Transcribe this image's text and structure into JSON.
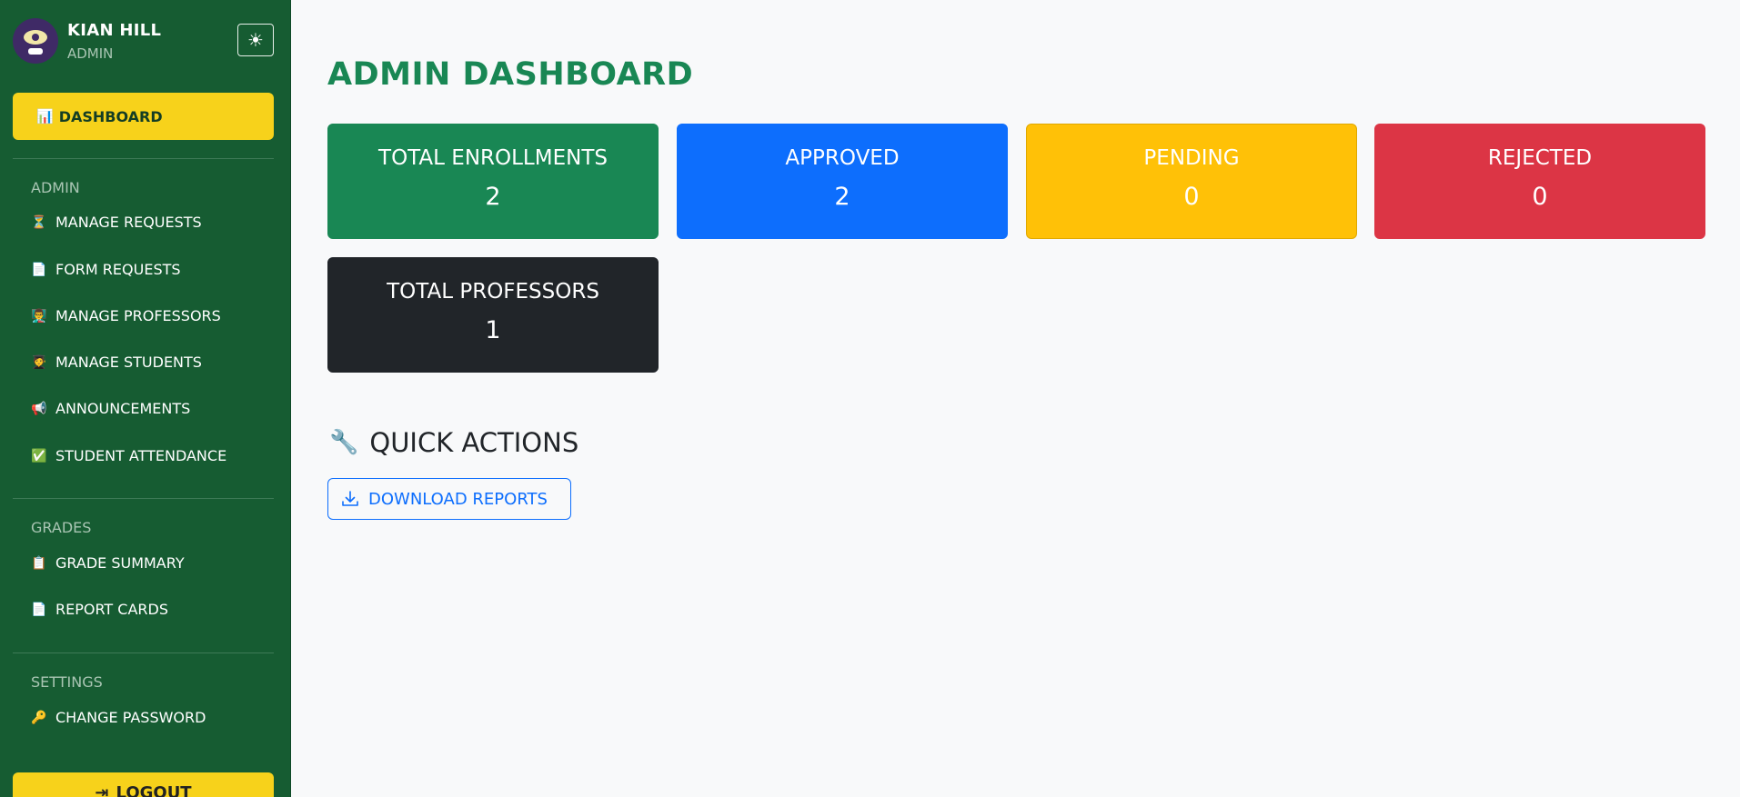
{
  "user": {
    "name": "KIAN HILL",
    "role": "ADMIN"
  },
  "theme_toggle_glyph": "☀",
  "sidebar": {
    "active": {
      "icon": "📊",
      "label": "DASHBOARD"
    },
    "sections": [
      {
        "label": "ADMIN",
        "items": [
          {
            "icon": "⏳",
            "label": "MANAGE REQUESTS"
          },
          {
            "icon": "📄",
            "label": "FORM REQUESTS"
          },
          {
            "icon": "👨‍🏫",
            "label": "MANAGE PROFESSORS"
          },
          {
            "icon": "🧑‍🎓",
            "label": "MANAGE STUDENTS"
          },
          {
            "icon": "📢",
            "label": "ANNOUNCEMENTS"
          },
          {
            "icon": "✅",
            "label": "STUDENT ATTENDANCE"
          }
        ]
      },
      {
        "label": "GRADES",
        "items": [
          {
            "icon": "📋",
            "label": "GRADE SUMMARY"
          },
          {
            "icon": "📄",
            "label": "REPORT CARDS"
          }
        ]
      },
      {
        "label": "SETTINGS",
        "items": [
          {
            "icon": "🔑",
            "label": "CHANGE PASSWORD"
          }
        ]
      }
    ],
    "logout": {
      "icon": "⇥",
      "label": "LOGOUT"
    }
  },
  "main": {
    "title": "ADMIN DASHBOARD",
    "cards": [
      {
        "title": "TOTAL ENROLLMENTS",
        "value": "2",
        "color": "#198754"
      },
      {
        "title": "APPROVED",
        "value": "2",
        "color": "#0d6efd"
      },
      {
        "title": "PENDING",
        "value": "0",
        "color": "#ffc107"
      },
      {
        "title": "REJECTED",
        "value": "0",
        "color": "#dc3545"
      },
      {
        "title": "TOTAL PROFESSORS",
        "value": "1",
        "color": "#212529"
      }
    ],
    "quick_actions": {
      "icon": "🔧",
      "title": "QUICK ACTIONS",
      "download_label": "DOWNLOAD REPORTS"
    }
  }
}
